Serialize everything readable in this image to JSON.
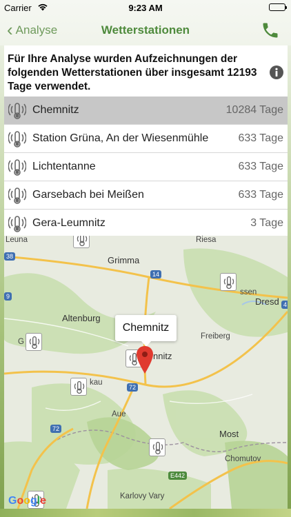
{
  "status_bar": {
    "carrier": "Carrier",
    "time": "9:23 AM"
  },
  "nav": {
    "back_label": "Analyse",
    "title": "Wetterstationen",
    "accent_color": "#6f9a5c"
  },
  "info": {
    "text": "Für Ihre Analyse wurden Aufzeichnungen der folgenden Wetterstationen über insgesamt 12193 Tage verwendet.",
    "icon": "info-icon"
  },
  "stations": [
    {
      "name": "Chemnitz",
      "days": "10284 Tage",
      "selected": true
    },
    {
      "name": "Station Grüna, An der Wiesenmühle",
      "days": "633 Tage",
      "selected": false
    },
    {
      "name": "Lichtentanne",
      "days": "633 Tage",
      "selected": false
    },
    {
      "name": "Garsebach bei Meißen",
      "days": "633 Tage",
      "selected": false
    },
    {
      "name": "Gera-Leumnitz",
      "days": "3 Tage",
      "selected": false
    }
  ],
  "map": {
    "callout": "Chemnitz",
    "labels": {
      "leuna": "Leuna",
      "riesa": "Riesa",
      "grimma": "Grimma",
      "meissen": "ssen",
      "dresden": "Dresd",
      "altenburg": "Altenburg",
      "freiberg": "Freiberg",
      "chemnitz": "nnitz",
      "zwickau": "kau",
      "aue": "Aue",
      "most": "Most",
      "chomutov": "Chomutov",
      "karlovy_vary": "Karlovy Vary",
      "gera": "G"
    },
    "shields": {
      "r38": "38",
      "r9": "9",
      "r14": "14",
      "r72a": "72",
      "r72b": "72",
      "r4": "4",
      "e442": "E442"
    },
    "google": [
      "G",
      "o",
      "o",
      "g",
      "l",
      "e"
    ]
  }
}
